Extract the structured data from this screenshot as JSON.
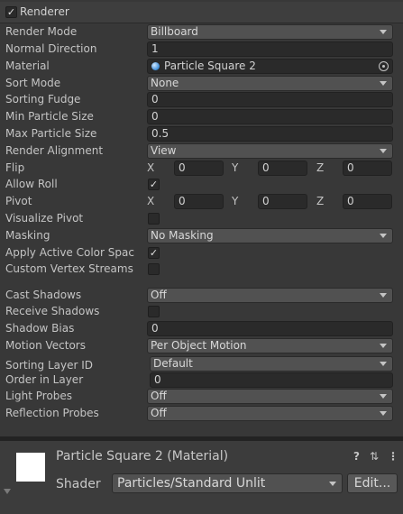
{
  "renderer": {
    "title": "Renderer",
    "enabled_check": "✓",
    "render_mode": {
      "label": "Render Mode",
      "value": "Billboard"
    },
    "normal_direction": {
      "label": "Normal Direction",
      "value": "1"
    },
    "material": {
      "label": "Material",
      "value": "Particle Square 2"
    },
    "sort_mode": {
      "label": "Sort Mode",
      "value": "None"
    },
    "sorting_fudge": {
      "label": "Sorting Fudge",
      "value": "0"
    },
    "min_particle_size": {
      "label": "Min Particle Size",
      "value": "0"
    },
    "max_particle_size": {
      "label": "Max Particle Size",
      "value": "0.5"
    },
    "render_alignment": {
      "label": "Render Alignment",
      "value": "View"
    },
    "flip": {
      "label": "Flip",
      "x_label": "X",
      "x": "0",
      "y_label": "Y",
      "y": "0",
      "z_label": "Z",
      "z": "0"
    },
    "allow_roll": {
      "label": "Allow Roll",
      "check": "✓"
    },
    "pivot": {
      "label": "Pivot",
      "x_label": "X",
      "x": "0",
      "y_label": "Y",
      "y": "0",
      "z_label": "Z",
      "z": "0"
    },
    "visualize_pivot": {
      "label": "Visualize Pivot",
      "check": ""
    },
    "masking": {
      "label": "Masking",
      "value": "No Masking"
    },
    "apply_active_color_space": {
      "label": "Apply Active Color Spac",
      "check": "✓"
    },
    "custom_vertex_streams": {
      "label": "Custom Vertex Streams",
      "check": ""
    },
    "cast_shadows": {
      "label": "Cast Shadows",
      "value": "Off"
    },
    "receive_shadows": {
      "label": "Receive Shadows",
      "check": ""
    },
    "shadow_bias": {
      "label": "Shadow Bias",
      "value": "0"
    },
    "motion_vectors": {
      "label": "Motion Vectors",
      "value": "Per Object Motion"
    },
    "sorting_layer_id": {
      "label": "Sorting Layer ID",
      "value": "Default"
    },
    "order_in_layer": {
      "label": "Order in Layer",
      "value": "0"
    },
    "light_probes": {
      "label": "Light Probes",
      "value": "Off"
    },
    "reflection_probes": {
      "label": "Reflection Probes",
      "value": "Off"
    }
  },
  "material_panel": {
    "title": "Particle Square 2 (Material)",
    "shader_label": "Shader",
    "shader_value": "Particles/Standard Unlit",
    "edit_button": "Edit...",
    "help_icon": "?",
    "settings_icon": "⇅",
    "menu_icon": "⋮"
  },
  "icons": [
    "checkmark-icon",
    "dropdown-arrow-icon",
    "material-sphere-icon",
    "object-picker-icon",
    "help-icon",
    "preset-icon",
    "menu-icon",
    "foldout-arrow-icon"
  ]
}
